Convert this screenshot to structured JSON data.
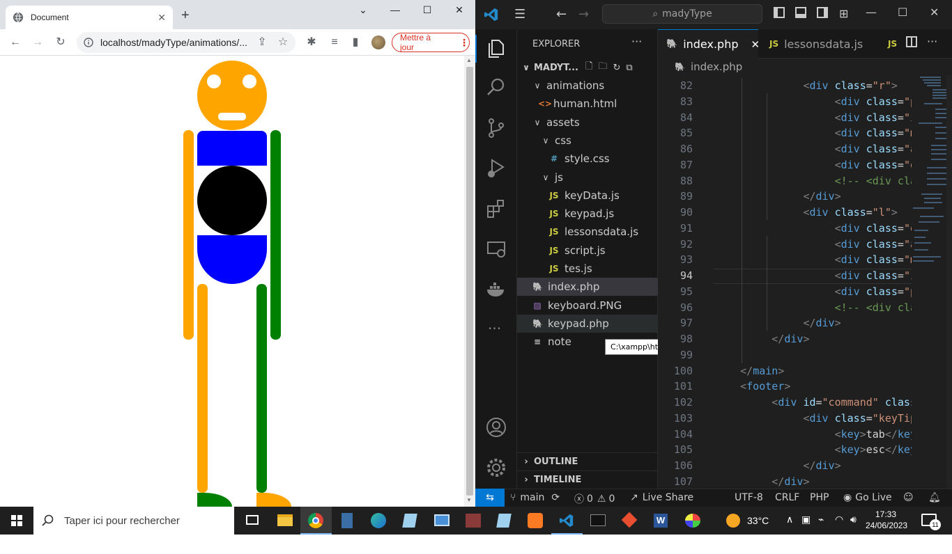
{
  "browser": {
    "tab_title": "Document",
    "url": "localhost/madyType/animations/...",
    "update_button": "Mettre à jour",
    "figure_colors": {
      "head": "#ffa500",
      "torso": "#0000ff",
      "belly": "#000000",
      "left_limbs": "#ffa500",
      "right_limbs": "#008000"
    }
  },
  "vscode": {
    "command_center": "madyType",
    "explorer_title": "EXPLORER",
    "root_folder": "MADYT...",
    "tree": [
      {
        "label": "animations",
        "kind": "folder",
        "icon": "chevron-down-icon"
      },
      {
        "label": "human.html",
        "kind": "html",
        "icon": "<>"
      },
      {
        "label": "assets",
        "kind": "folder",
        "icon": "chevron-down-icon"
      },
      {
        "label": "css",
        "kind": "folder",
        "icon": "chevron-down-icon"
      },
      {
        "label": "style.css",
        "kind": "css",
        "icon": "#"
      },
      {
        "label": "js",
        "kind": "folder",
        "icon": "chevron-down-icon"
      },
      {
        "label": "keyData.js",
        "kind": "js",
        "icon": "JS"
      },
      {
        "label": "keypad.js",
        "kind": "js",
        "icon": "JS"
      },
      {
        "label": "lessonsdata.js",
        "kind": "js",
        "icon": "JS"
      },
      {
        "label": "script.js",
        "kind": "js",
        "icon": "JS"
      },
      {
        "label": "tes.js",
        "kind": "js",
        "icon": "JS"
      },
      {
        "label": "index.php",
        "kind": "php",
        "icon": "php-icon"
      },
      {
        "label": "keyboard.PNG",
        "kind": "image",
        "icon": "image-icon"
      },
      {
        "label": "keypad.php",
        "kind": "php",
        "icon": "php-icon"
      },
      {
        "label": "note",
        "kind": "text",
        "icon": "≡"
      }
    ],
    "tooltip": "C:\\xampp\\htdocs\\madyType\\keypad.php",
    "outline_label": "OUTLINE",
    "timeline_label": "TIMELINE",
    "tabs": [
      {
        "label": "index.php",
        "active": true,
        "close": "✕"
      },
      {
        "label": "lessonsdata.js",
        "active": false,
        "icon": "JS"
      },
      {
        "label": "",
        "active": false,
        "icon": "JS"
      }
    ],
    "breadcrumb": "index.php",
    "line_numbers": [
      "82",
      "83",
      "84",
      "85",
      "86",
      "87",
      "88",
      "89",
      "90",
      "91",
      "92",
      "93",
      "94",
      "95",
      "96",
      "97",
      "98",
      "99",
      "100",
      "101",
      "102",
      "103",
      "104",
      "105",
      "106",
      "107"
    ],
    "current_line": "94",
    "status": {
      "branch": "main",
      "errors": "0",
      "warnings": "0",
      "live_share": "Live Share",
      "encoding": "UTF-8",
      "eol": "CRLF",
      "language": "PHP",
      "go_live": "Go Live"
    }
  },
  "taskbar": {
    "search_placeholder": "Taper ici pour rechercher",
    "temperature": "33°C",
    "time": "17:33",
    "date": "24/06/2023",
    "notifications": "11"
  }
}
